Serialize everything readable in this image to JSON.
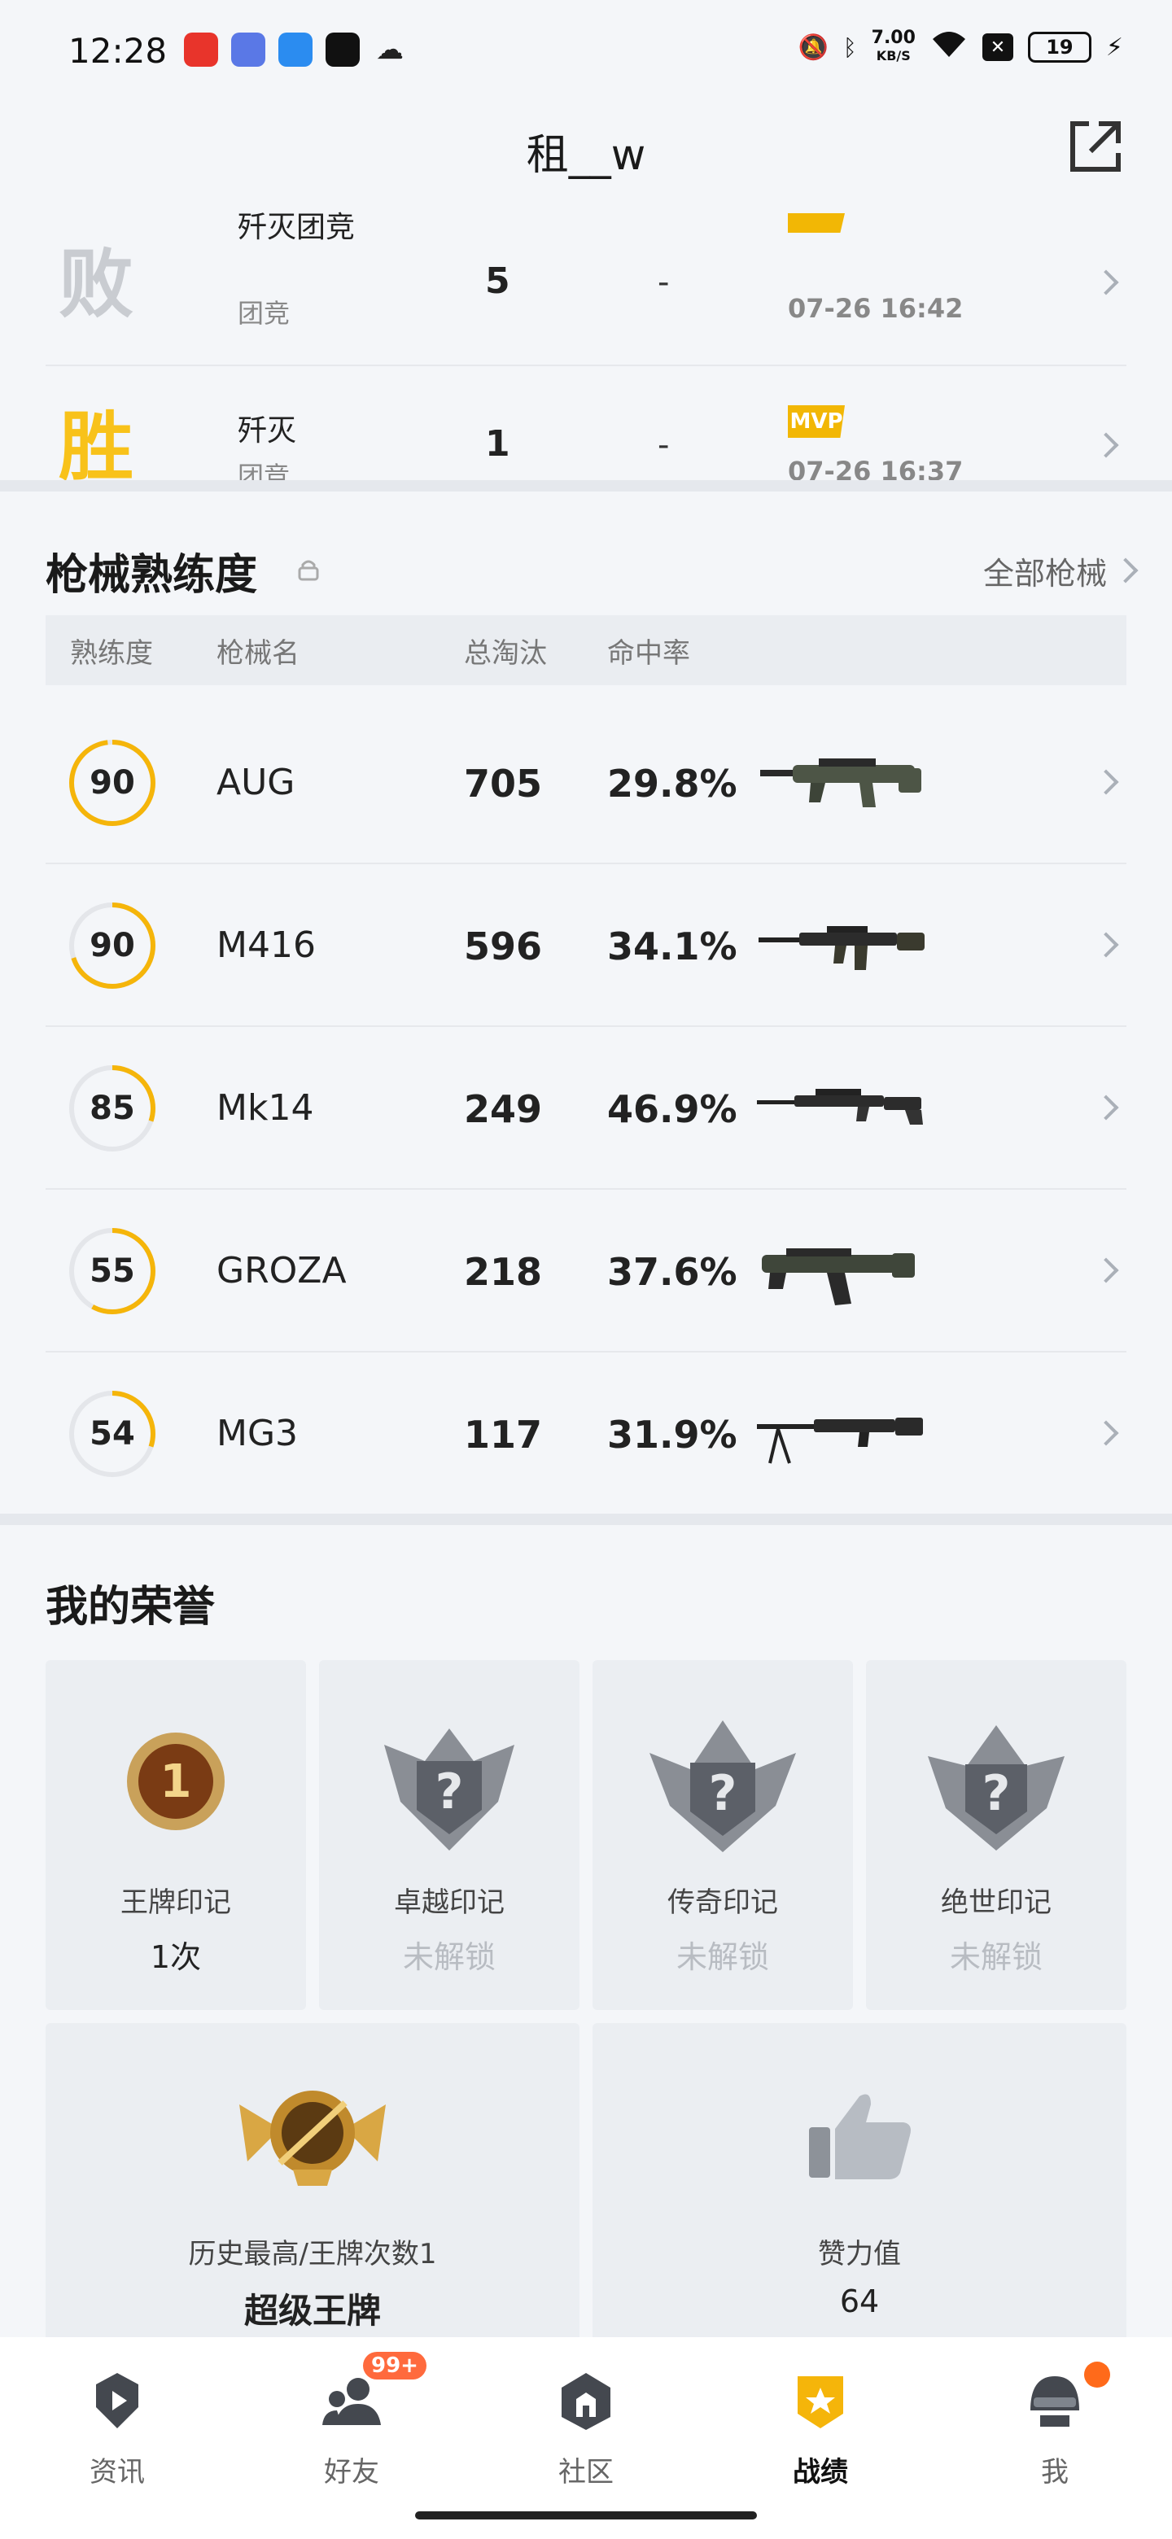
{
  "status_bar": {
    "time": "12:28",
    "net_speed_value": "7.00",
    "net_speed_unit": "KB/S",
    "battery": "19"
  },
  "header": {
    "title": "租__w"
  },
  "matches": [
    {
      "result": "败",
      "mode": "歼灭团竞",
      "type": "团竞",
      "rank": "5",
      "kills": "-",
      "mvp": "",
      "date": "07-26 16:42"
    },
    {
      "result": "胜",
      "mode": "歼灭",
      "type": "团竞",
      "rank": "1",
      "kills": "-",
      "mvp": "MVP",
      "date": "07-26 16:37"
    }
  ],
  "weapons": {
    "title": "枪械熟练度",
    "all_link": "全部枪械",
    "columns": [
      "熟练度",
      "枪械名",
      "总淘汰",
      "命中率"
    ],
    "rows": [
      {
        "proficiency": "90",
        "progress": 0.98,
        "name": "AUG",
        "kills": "705",
        "rate": "29.8%"
      },
      {
        "proficiency": "90",
        "progress": 0.7,
        "name": "M416",
        "kills": "596",
        "rate": "34.1%"
      },
      {
        "proficiency": "85",
        "progress": 0.3,
        "name": "Mk14",
        "kills": "249",
        "rate": "46.9%"
      },
      {
        "proficiency": "55",
        "progress": 0.58,
        "name": "GROZA",
        "kills": "218",
        "rate": "37.6%"
      },
      {
        "proficiency": "54",
        "progress": 0.3,
        "name": "MG3",
        "kills": "117",
        "rate": "31.9%"
      }
    ]
  },
  "honors": {
    "title": "我的荣誉",
    "marks": [
      {
        "label": "王牌印记",
        "value": "1次",
        "locked": false
      },
      {
        "label": "卓越印记",
        "value": "未解锁",
        "locked": true
      },
      {
        "label": "传奇印记",
        "value": "未解锁",
        "locked": true
      },
      {
        "label": "绝世印记",
        "value": "未解锁",
        "locked": true
      }
    ],
    "best": {
      "label": "历史最高/王牌次数1",
      "value": "超级王牌"
    },
    "likes": {
      "label": "赞力值",
      "value": "64"
    }
  },
  "nav": {
    "items": [
      "资讯",
      "好友",
      "社区",
      "战绩",
      "我"
    ],
    "friends_badge": "99+",
    "active": "战绩"
  },
  "colors": {
    "accent": "#f5b50a",
    "lose": "#c9ccd1",
    "win": "#f8c21a"
  }
}
